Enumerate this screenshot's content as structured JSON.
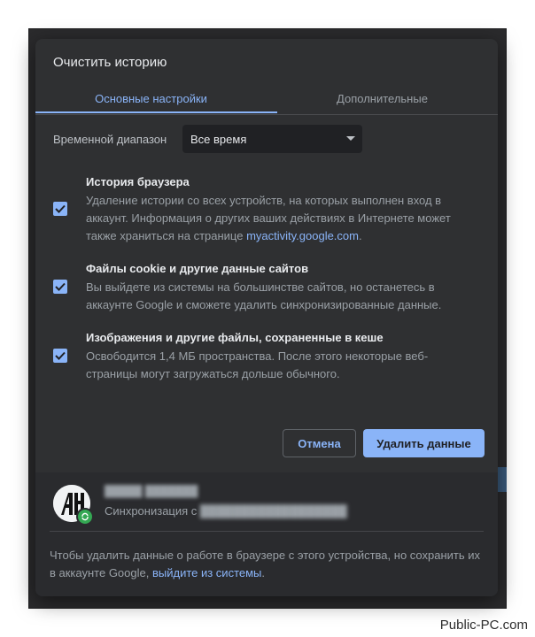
{
  "dialog": {
    "title": "Очистить историю",
    "tabs": [
      {
        "label": "Основные настройки",
        "active": true
      },
      {
        "label": "Дополнительные",
        "active": false
      }
    ],
    "time_range": {
      "label": "Временной диапазон",
      "value": "Все время"
    },
    "options": [
      {
        "title": "История браузера",
        "description": "Удаление истории со всех устройств, на которых выполнен вход в аккаунт. Информация о других ваших действиях в Интернете может также храниться на странице ",
        "link": "myactivity.google.com",
        "description_after": ".",
        "checked": true
      },
      {
        "title": "Файлы cookie и другие данные сайтов",
        "description": "Вы выйдете из системы на большинстве сайтов, но останетесь в аккаунте Google и сможете удалить синхронизированные данные.",
        "checked": true
      },
      {
        "title": "Изображения и другие файлы, сохраненные в кеше",
        "description": "Освободится 1,4 МБ пространства. После этого некоторые веб-страницы могут загружаться дольше обычного.",
        "checked": true
      }
    ],
    "buttons": {
      "cancel": "Отмена",
      "delete": "Удалить данные"
    },
    "account": {
      "sync_prefix": "Синхронизация с "
    },
    "footer_note": {
      "text": "Чтобы удалить данные о работе в браузере с этого устройства, но сохранить их в аккаунте Google, ",
      "link": "выйдите из системы",
      "after": "."
    }
  },
  "watermark": "Public-PC.com",
  "colors": {
    "accent": "#8ab4f8",
    "dialog_bg": "#2f3032",
    "text_primary": "#e8eaed",
    "text_secondary": "#9aa0a6",
    "sync_badge": "#34a853"
  }
}
